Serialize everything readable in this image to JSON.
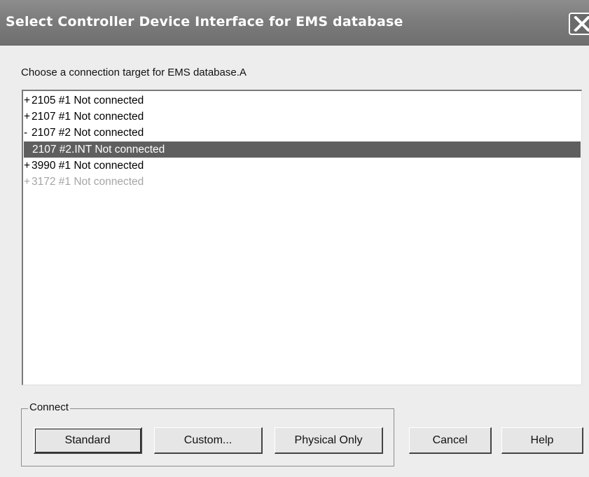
{
  "window": {
    "title": "Select Controller Device Interface for EMS database",
    "close_icon": "close-x-icon"
  },
  "prompt": "Choose a connection target for EMS database.A",
  "list": {
    "items": [
      {
        "prefix": "+",
        "text": "2105 #1 Not connected",
        "state": "normal"
      },
      {
        "prefix": "+",
        "text": "2107 #1 Not connected",
        "state": "normal"
      },
      {
        "prefix": "-",
        "text": "2107 #2 Not connected",
        "state": "normal"
      },
      {
        "prefix": "",
        "text": "2107 #2.INT Not connected",
        "state": "selected"
      },
      {
        "prefix": "+",
        "text": "3990 #1 Not connected",
        "state": "normal"
      },
      {
        "prefix": "+",
        "text": "3172 #1 Not connected",
        "state": "disabled"
      }
    ]
  },
  "connect_group": {
    "label": "Connect",
    "standard_label": "Standard",
    "custom_label": "Custom...",
    "physical_only_label": "Physical Only"
  },
  "buttons": {
    "cancel_label": "Cancel",
    "help_label": "Help"
  },
  "colors": {
    "titlebar": "#7c7c7c",
    "selection": "#5f5f5f",
    "disabled_text": "#a5a5a5"
  }
}
